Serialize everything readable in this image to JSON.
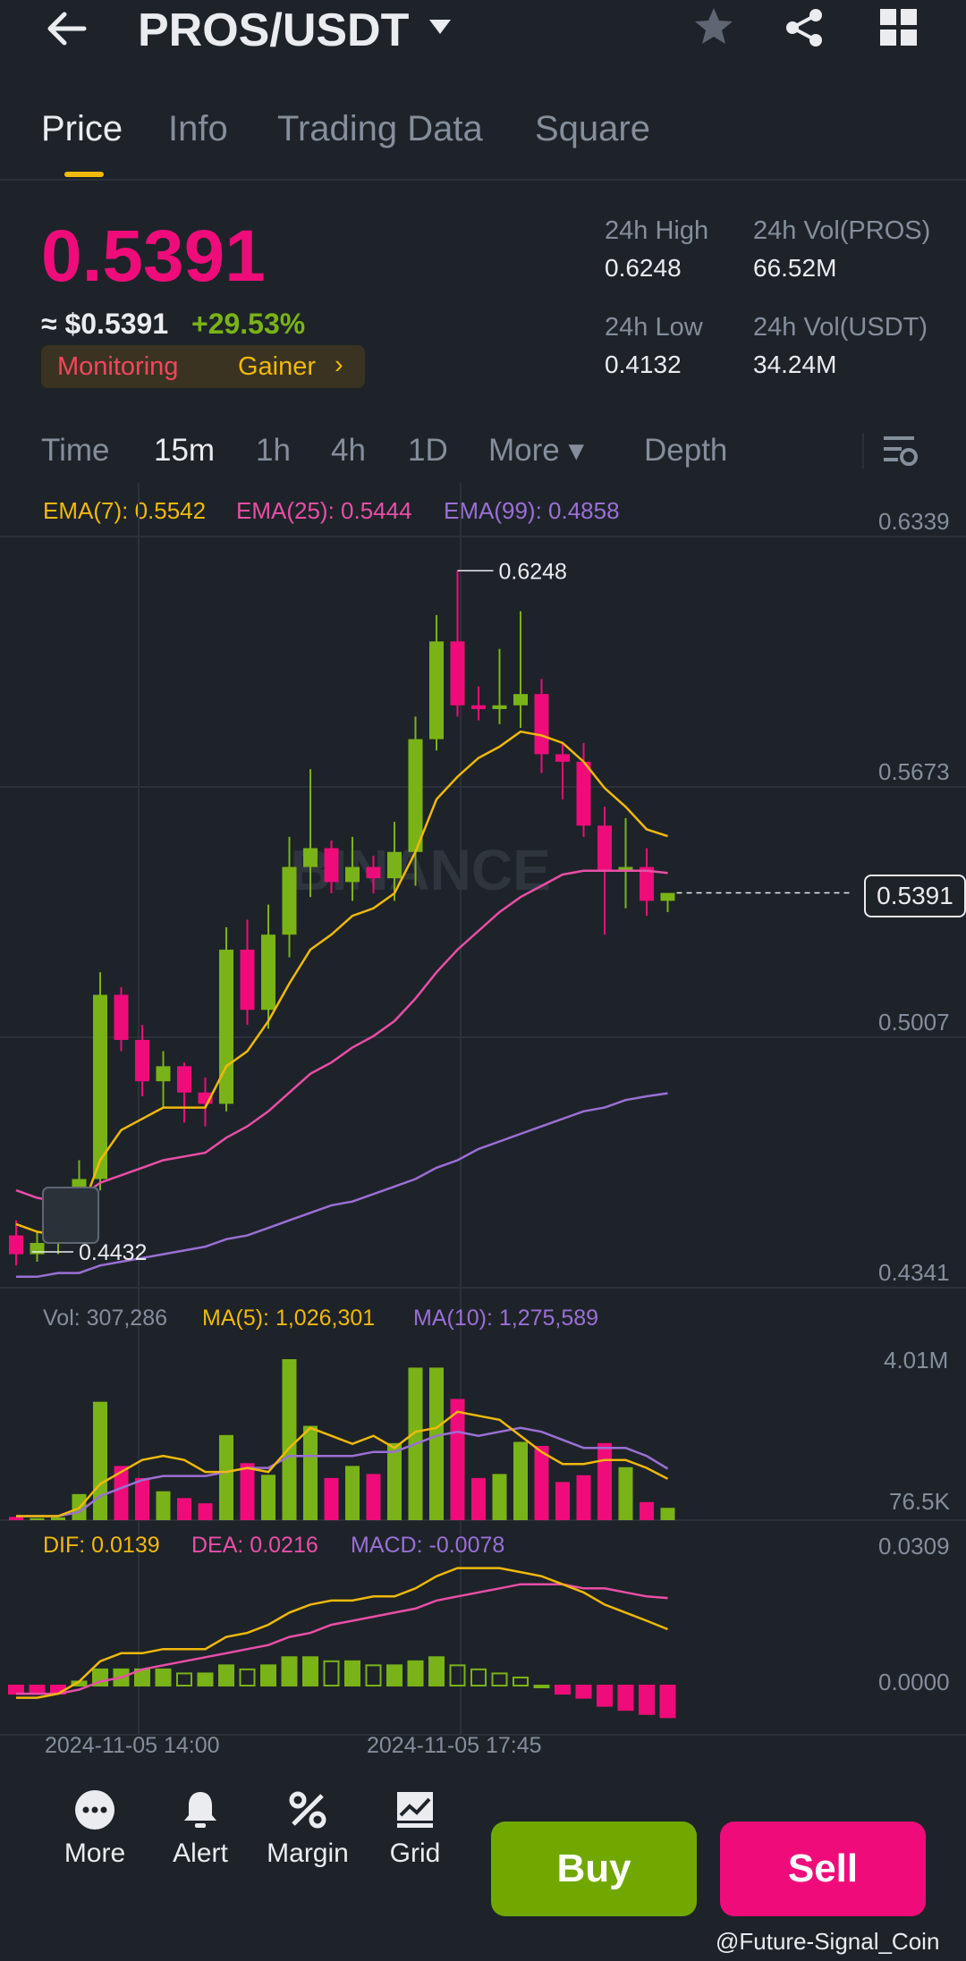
{
  "header": {
    "pair": "PROS/USDT",
    "icons": [
      "back-arrow-icon",
      "caret-down-icon",
      "star-icon",
      "share-icon",
      "grid-icon"
    ]
  },
  "tabs": [
    {
      "label": "Price",
      "active": true
    },
    {
      "label": "Info",
      "active": false
    },
    {
      "label": "Trading Data",
      "active": false
    },
    {
      "label": "Square",
      "active": false
    }
  ],
  "ticker": {
    "price": "0.5391",
    "price_usd": "≈ $0.5391",
    "change": "+29.53%",
    "tag_monitoring": "Monitoring",
    "tag_gainer": "Gainer",
    "tag_chevron": "›",
    "high_label": "24h High",
    "high_value": "0.6248",
    "low_label": "24h Low",
    "low_value": "0.4132",
    "vol_base_label": "24h Vol(PROS)",
    "vol_base_value": "66.52M",
    "vol_quote_label": "24h Vol(USDT)",
    "vol_quote_value": "34.24M"
  },
  "intervals": [
    {
      "label": "Time",
      "active": false
    },
    {
      "label": "15m",
      "active": true
    },
    {
      "label": "1h",
      "active": false
    },
    {
      "label": "4h",
      "active": false
    },
    {
      "label": "1D",
      "active": false
    },
    {
      "label": "More ▾",
      "active": false
    },
    {
      "label": "Depth",
      "active": false
    }
  ],
  "indicators": {
    "ema7": "EMA(7): 0.5542",
    "ema25": "EMA(25): 0.5444",
    "ema99": "EMA(99): 0.4858",
    "vol": "Vol: 307,286",
    "ma5": "MA(5): 1,026,301",
    "ma10": "MA(10): 1,275,589",
    "dif": "DIF: 0.0139",
    "dea": "DEA: 0.0216",
    "macd": "MACD: -0.0078"
  },
  "axes": {
    "price_ticks": [
      "0.6339",
      "0.5673",
      "0.5007",
      "0.4341"
    ],
    "vol_ticks": [
      "4.01M",
      "76.5K"
    ],
    "macd_ticks": [
      "0.0309",
      "0.0000"
    ],
    "time_ticks": [
      "2024-11-05 14:00",
      "2024-11-05 17:45"
    ],
    "current_price": "0.5391",
    "high_marker": "0.6248",
    "low_marker": "0.4432",
    "watermark": "BINANCE"
  },
  "colors": {
    "up": "#7ab317",
    "down": "#ef0c7a",
    "ema7": "#f0b90b",
    "ema25": "#e94ea8",
    "ema99": "#9b6fd6",
    "background": "#1e2329"
  },
  "chart_data": {
    "type": "candlestick",
    "ylim": [
      0.4341,
      0.6339
    ],
    "candles": [
      {
        "o": 0.448,
        "h": 0.452,
        "l": 0.44,
        "c": 0.443
      },
      {
        "o": 0.443,
        "h": 0.449,
        "l": 0.441,
        "c": 0.446
      },
      {
        "o": 0.446,
        "h": 0.452,
        "l": 0.443,
        "c": 0.449
      },
      {
        "o": 0.449,
        "h": 0.468,
        "l": 0.446,
        "c": 0.463
      },
      {
        "o": 0.463,
        "h": 0.518,
        "l": 0.46,
        "c": 0.512
      },
      {
        "o": 0.512,
        "h": 0.514,
        "l": 0.497,
        "c": 0.5
      },
      {
        "o": 0.5,
        "h": 0.504,
        "l": 0.485,
        "c": 0.489
      },
      {
        "o": 0.489,
        "h": 0.497,
        "l": 0.482,
        "c": 0.493
      },
      {
        "o": 0.493,
        "h": 0.494,
        "l": 0.478,
        "c": 0.486
      },
      {
        "o": 0.486,
        "h": 0.49,
        "l": 0.477,
        "c": 0.483
      },
      {
        "o": 0.483,
        "h": 0.53,
        "l": 0.481,
        "c": 0.524
      },
      {
        "o": 0.524,
        "h": 0.532,
        "l": 0.504,
        "c": 0.508
      },
      {
        "o": 0.508,
        "h": 0.536,
        "l": 0.503,
        "c": 0.528
      },
      {
        "o": 0.528,
        "h": 0.554,
        "l": 0.522,
        "c": 0.546
      },
      {
        "o": 0.546,
        "h": 0.572,
        "l": 0.538,
        "c": 0.551
      },
      {
        "o": 0.551,
        "h": 0.553,
        "l": 0.539,
        "c": 0.542
      },
      {
        "o": 0.542,
        "h": 0.554,
        "l": 0.537,
        "c": 0.546
      },
      {
        "o": 0.546,
        "h": 0.549,
        "l": 0.539,
        "c": 0.543
      },
      {
        "o": 0.543,
        "h": 0.558,
        "l": 0.537,
        "c": 0.55
      },
      {
        "o": 0.55,
        "h": 0.586,
        "l": 0.541,
        "c": 0.58
      },
      {
        "o": 0.58,
        "h": 0.613,
        "l": 0.577,
        "c": 0.606
      },
      {
        "o": 0.606,
        "h": 0.6248,
        "l": 0.586,
        "c": 0.589
      },
      {
        "o": 0.589,
        "h": 0.594,
        "l": 0.585,
        "c": 0.588
      },
      {
        "o": 0.588,
        "h": 0.604,
        "l": 0.584,
        "c": 0.589
      },
      {
        "o": 0.589,
        "h": 0.614,
        "l": 0.583,
        "c": 0.592
      },
      {
        "o": 0.592,
        "h": 0.596,
        "l": 0.571,
        "c": 0.576
      },
      {
        "o": 0.576,
        "h": 0.579,
        "l": 0.564,
        "c": 0.574
      },
      {
        "o": 0.574,
        "h": 0.579,
        "l": 0.554,
        "c": 0.557
      },
      {
        "o": 0.557,
        "h": 0.562,
        "l": 0.528,
        "c": 0.545
      },
      {
        "o": 0.545,
        "h": 0.559,
        "l": 0.535,
        "c": 0.546
      },
      {
        "o": 0.546,
        "h": 0.551,
        "l": 0.533,
        "c": 0.537
      },
      {
        "o": 0.537,
        "h": 0.539,
        "l": 0.534,
        "c": 0.5391
      }
    ],
    "ema7": [
      0.451,
      0.449,
      0.448,
      0.453,
      0.468,
      0.476,
      0.479,
      0.482,
      0.482,
      0.482,
      0.493,
      0.497,
      0.505,
      0.515,
      0.524,
      0.528,
      0.533,
      0.535,
      0.539,
      0.55,
      0.564,
      0.57,
      0.575,
      0.578,
      0.582,
      0.581,
      0.579,
      0.574,
      0.567,
      0.562,
      0.556,
      0.5542
    ],
    "ema25": [
      0.46,
      0.458,
      0.457,
      0.458,
      0.462,
      0.464,
      0.466,
      0.468,
      0.469,
      0.47,
      0.474,
      0.477,
      0.481,
      0.486,
      0.491,
      0.494,
      0.498,
      0.501,
      0.505,
      0.511,
      0.518,
      0.524,
      0.529,
      0.534,
      0.538,
      0.541,
      0.544,
      0.545,
      0.545,
      0.545,
      0.545,
      0.5444
    ],
    "ema99": [
      0.437,
      0.437,
      0.438,
      0.438,
      0.44,
      0.441,
      0.442,
      0.443,
      0.444,
      0.445,
      0.447,
      0.448,
      0.45,
      0.452,
      0.454,
      0.456,
      0.457,
      0.459,
      0.461,
      0.463,
      0.466,
      0.468,
      0.471,
      0.473,
      0.475,
      0.477,
      0.479,
      0.481,
      0.482,
      0.484,
      0.485,
      0.4858
    ],
    "volume": [
      0.08,
      0.05,
      0.07,
      0.65,
      2.95,
      1.35,
      1.05,
      0.72,
      0.55,
      0.42,
      2.12,
      1.42,
      1.13,
      4.01,
      2.35,
      1.05,
      1.35,
      1.15,
      1.92,
      3.8,
      3.8,
      3.02,
      1.05,
      1.15,
      1.95,
      1.85,
      0.95,
      1.12,
      1.92,
      1.32,
      0.45,
      0.307
    ],
    "vol_ma5": [
      0.1,
      0.1,
      0.1,
      0.3,
      0.9,
      1.2,
      1.5,
      1.6,
      1.5,
      1.2,
      1.2,
      1.3,
      1.2,
      1.8,
      2.3,
      2.1,
      1.9,
      2.1,
      1.8,
      2.2,
      2.3,
      2.7,
      2.6,
      2.5,
      2.1,
      1.7,
      1.4,
      1.4,
      1.5,
      1.5,
      1.3,
      1.03
    ],
    "vol_ma10": [
      0.1,
      0.1,
      0.1,
      0.2,
      0.6,
      0.8,
      1.0,
      1.1,
      1.1,
      1.1,
      1.2,
      1.3,
      1.3,
      1.6,
      1.6,
      1.6,
      1.6,
      1.7,
      1.7,
      1.9,
      2.1,
      2.2,
      2.1,
      2.2,
      2.3,
      2.2,
      2.0,
      1.8,
      1.8,
      1.8,
      1.6,
      1.28
    ],
    "macd_hist": [
      -0.002,
      -0.002,
      -0.002,
      0.001,
      0.004,
      0.004,
      0.004,
      0.004,
      0.003,
      0.003,
      0.005,
      0.004,
      0.005,
      0.007,
      0.007,
      0.006,
      0.006,
      0.005,
      0.005,
      0.006,
      0.007,
      0.005,
      0.004,
      0.003,
      0.002,
      0.0,
      -0.002,
      -0.003,
      -0.005,
      -0.006,
      -0.007,
      -0.0078
    ],
    "dif": [
      -0.003,
      -0.003,
      -0.002,
      0.001,
      0.006,
      0.008,
      0.008,
      0.009,
      0.009,
      0.009,
      0.012,
      0.013,
      0.015,
      0.018,
      0.02,
      0.021,
      0.021,
      0.022,
      0.022,
      0.024,
      0.027,
      0.029,
      0.029,
      0.029,
      0.028,
      0.027,
      0.025,
      0.023,
      0.02,
      0.018,
      0.016,
      0.0139
    ],
    "dea": [
      -0.002,
      -0.002,
      -0.002,
      -0.001,
      0.001,
      0.002,
      0.004,
      0.005,
      0.006,
      0.007,
      0.008,
      0.009,
      0.01,
      0.012,
      0.013,
      0.015,
      0.016,
      0.017,
      0.018,
      0.019,
      0.021,
      0.022,
      0.023,
      0.024,
      0.025,
      0.025,
      0.025,
      0.024,
      0.024,
      0.023,
      0.022,
      0.0216
    ]
  },
  "bottom_nav": [
    {
      "label": "More",
      "icon": "more-dots-icon"
    },
    {
      "label": "Alert",
      "icon": "bell-icon"
    },
    {
      "label": "Margin",
      "icon": "percent-icon"
    },
    {
      "label": "Grid",
      "icon": "grid-chart-icon"
    }
  ],
  "actions": {
    "buy": "Buy",
    "sell": "Sell"
  },
  "credit": "@Future-Signal_Coin"
}
